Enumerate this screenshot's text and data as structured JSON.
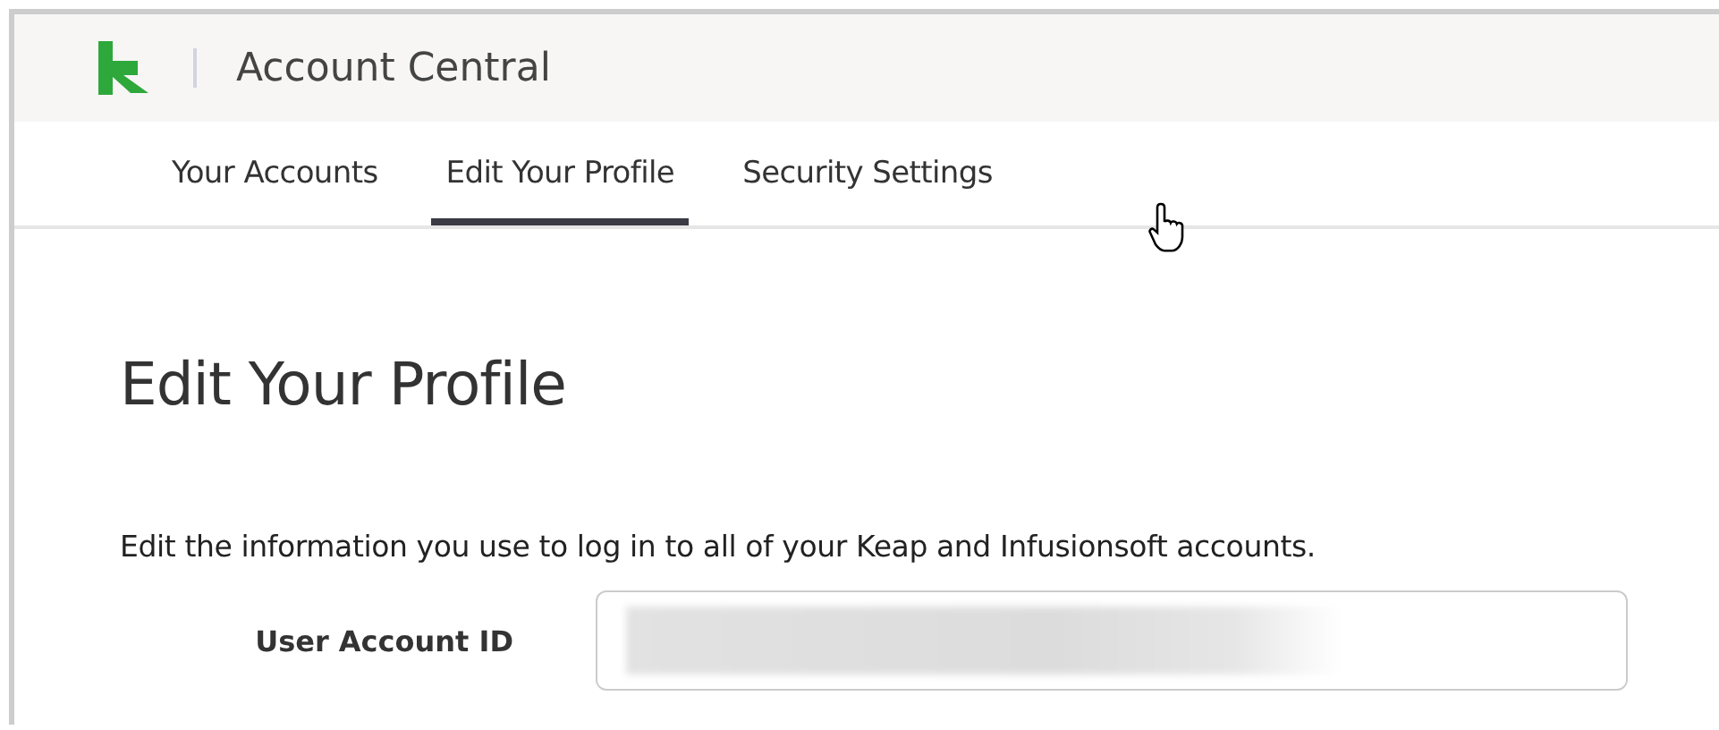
{
  "header": {
    "title": "Account Central"
  },
  "tabs": [
    {
      "label": "Your Accounts",
      "selected": false
    },
    {
      "label": "Edit Your Profile",
      "selected": true
    },
    {
      "label": "Security Settings",
      "selected": false
    }
  ],
  "page": {
    "heading": "Edit Your Profile",
    "description": "Edit the information you use to log in to all of your Keap and Infusionsoft accounts.",
    "fields": [
      {
        "label": "User Account ID"
      }
    ]
  }
}
